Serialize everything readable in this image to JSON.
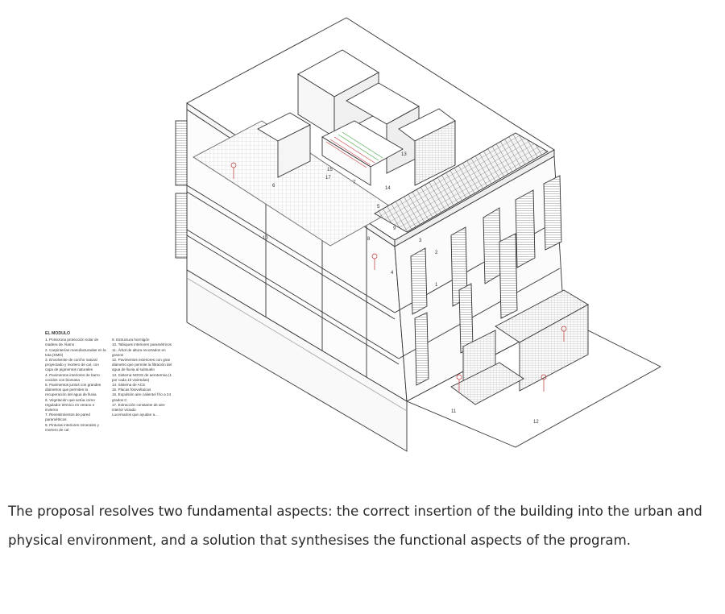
{
  "drawing": {
    "numbers": [
      "1",
      "2",
      "3",
      "4",
      "5",
      "6",
      "7",
      "8",
      "9",
      "10",
      "11",
      "12",
      "13",
      "14",
      "15",
      "17"
    ]
  },
  "legend": {
    "title": "EL MÓDULO",
    "col1": [
      "1. Portezona protección solar de madera de Álamo",
      "2. Carpinterías manufacturadas en la tota (KMD)",
      "3. Envolvente de corcho natural proyectado y mortero de cal, con capa de pigmentos naturales",
      "4. Pavimentos interiores de barro cocidos con biomasa",
      "5. Pavimentos juntos con grandes diámetros que permiten la recuperación del agua de lluvia",
      "6. Vegetación que actúa como regulador térmico en verano e invierno",
      "7. Revestimientos de pared paramétricos",
      "8. Pinturas interiores minerales y mortero de cal"
    ],
    "col2": [
      "9. Estructura hormigón",
      "10. Tabiques interiores paramétricos",
      "11. Árbol de altura recortados en granos",
      "12. Pavimentos exteriores con gran diámetro que permite la filtración del agua de lluvia al subsuelo",
      "13. Sistema NOOS de aerotermia (1 por cada 10 viviendas)",
      "14. Sistema de ACS",
      "15. Placas fotovoltaicas",
      "16. Expulsión aire caliente/ frío a 24 grados C",
      "17. Extracción constante de aire interior viciado",
      "Lucernarios que ayudan a..."
    ]
  },
  "caption": "The proposal resolves two fundamental aspects: the correct insertion of the building into the urban and physical environment, and a solution that synthesises the functional aspects of the program."
}
